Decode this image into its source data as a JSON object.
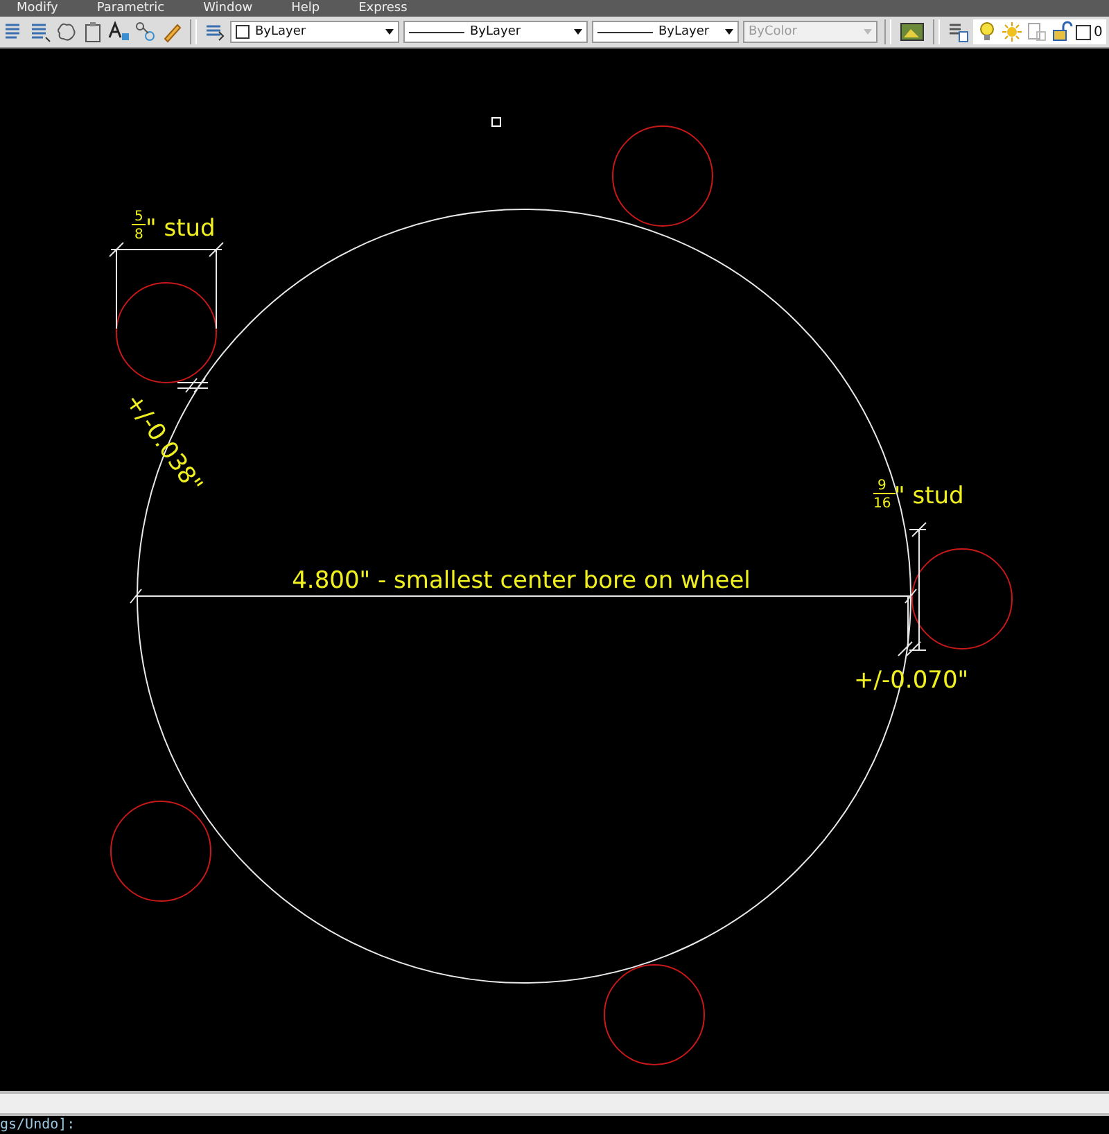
{
  "menu_bar": {
    "items": [
      "Modify",
      "Parametric",
      "Window",
      "Help",
      "Express"
    ]
  },
  "toolbar": {
    "dropdowns": [
      {
        "kind": "color",
        "value": "ByLayer",
        "disabled": false
      },
      {
        "kind": "linetype",
        "value": "ByLayer",
        "disabled": false
      },
      {
        "kind": "lineweight",
        "value": "ByLayer",
        "disabled": false
      },
      {
        "kind": "plotstyle",
        "value": "ByColor",
        "disabled": true
      }
    ],
    "layer": {
      "name": "0",
      "on": true,
      "unlocked": true
    }
  },
  "drawing": {
    "bore_dimension": "4.800\" - smallest center bore on wheel",
    "studs": [
      {
        "numerator": "5",
        "denominator": "8",
        "text": "\" stud",
        "tolerance": "+/-0.038\""
      },
      {
        "numerator": "9",
        "denominator": "16",
        "text": "\" stud",
        "tolerance": "+/-0.070\""
      }
    ]
  },
  "command_line": {
    "text": "gs/Undo]:"
  }
}
